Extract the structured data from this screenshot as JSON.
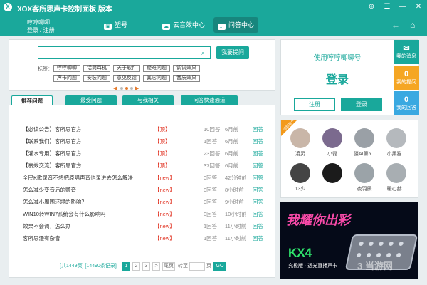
{
  "app": {
    "logo_glyph": "X",
    "title": "XOX客所思声卡控制面板 版本",
    "controls": [
      "⊕",
      "☰",
      "—",
      "✕"
    ]
  },
  "user": {
    "name": "哼哼唧唧",
    "login_register": "登录 / 注册"
  },
  "nav": {
    "items": [
      {
        "label": "塑号",
        "icon": "▣"
      },
      {
        "label": "云音效中心",
        "icon": "☁"
      },
      {
        "label": "问答中心",
        "icon": "…"
      }
    ],
    "back_icon": "←",
    "home_icon": "⌂"
  },
  "search": {
    "placeholder": "",
    "button_icon": "⌕",
    "ask_label": "我要提问"
  },
  "tags": {
    "label": "标签：",
    "items": [
      "哼哼唧唧",
      "话筒耳机",
      "关于软件",
      "疑难问题",
      "调试效果",
      "声卡问题",
      "安装问题",
      "意见反馈",
      "其它问题",
      "音质效果"
    ],
    "prev": "◀",
    "next": "▶"
  },
  "tabs": [
    "推荐问题",
    "最受问题",
    "与我相关",
    "问答快速通道"
  ],
  "questions": [
    {
      "title": "【必读公告】客所思官方",
      "badge": "【顶】",
      "answers": "10回答",
      "time": "6月前",
      "action": "回答"
    },
    {
      "title": "【联系我们】客所思官方",
      "badge": "【顶】",
      "answers": "1回答",
      "time": "6月前",
      "action": "回答"
    },
    {
      "title": "【灌水专用】客所思官方",
      "badge": "【顶】",
      "answers": "23回答",
      "time": "6月前",
      "action": "回答"
    },
    {
      "title": "【裹效交流】客所思官方",
      "badge": "【顶】",
      "answers": "37回答",
      "time": "6月前",
      "action": "回答"
    },
    {
      "title": "全民K歌录音不想把原唱声音也录进去怎么解决",
      "badge": "【new】",
      "answers": "0回答",
      "time": "42分钟前",
      "action": "回答"
    },
    {
      "title": "怎么减少变音后的颤音",
      "badge": "【new】",
      "answers": "0回答",
      "time": "8小时前",
      "action": "回答"
    },
    {
      "title": "怎么减小周围环境的影响？",
      "badge": "【new】",
      "answers": "0回答",
      "time": "9小时前",
      "action": "回答"
    },
    {
      "title": "WIN10转WIN7系统会有什么影响吗",
      "badge": "【new】",
      "answers": "0回答",
      "time": "10小时前",
      "action": "回答"
    },
    {
      "title": "效果不会调，怎么办",
      "badge": "【new】",
      "answers": "1回答",
      "time": "11小时前",
      "action": "回答"
    },
    {
      "title": "客所思漫有杂音",
      "badge": "【new】",
      "answers": "1回答",
      "time": "11小时前",
      "action": "回答"
    }
  ],
  "pagination": {
    "summary": "[共1449页] [14490条记录]",
    "pages": [
      "1",
      "2",
      "3"
    ],
    "next": ">",
    "last": "尾页",
    "goto": "转至",
    "page_unit": "页",
    "go": "GO",
    "current_page": 1
  },
  "login": {
    "hint": "使用哼哼唧唧号",
    "title": "登录",
    "register": "注册",
    "login": "登录"
  },
  "side_tiles": [
    {
      "num": "✉",
      "label": "我的消息",
      "color": "#19a89b"
    },
    {
      "num": "0",
      "label": "我的提问",
      "color": "#f5a623"
    },
    {
      "num": "0",
      "label": "我的回答",
      "color": "#3aa9e1"
    }
  ],
  "active_users": {
    "ribbon": "活跃用户",
    "users": [
      {
        "name": "凌灵",
        "color": "#c9b6a8"
      },
      {
        "name": "小磊",
        "color": "#7b6a8e"
      },
      {
        "name": "疆AI第5...",
        "color": "#9aa0a6"
      },
      {
        "name": "小黑猫...",
        "color": "#b5b9bd"
      },
      {
        "name": "13少",
        "color": "#444444"
      },
      {
        "name": "",
        "color": "#1b1b1b"
      },
      {
        "name": "夜羽辰",
        "color": "#9ba3a8"
      },
      {
        "name": "暖心赫...",
        "color": "#a8aeb2"
      }
    ]
  },
  "banner": {
    "title": "我耀你出彩",
    "model": "KX4",
    "sub": "究极版 · 透光直播声卡",
    "watermark": "3 当游网"
  }
}
